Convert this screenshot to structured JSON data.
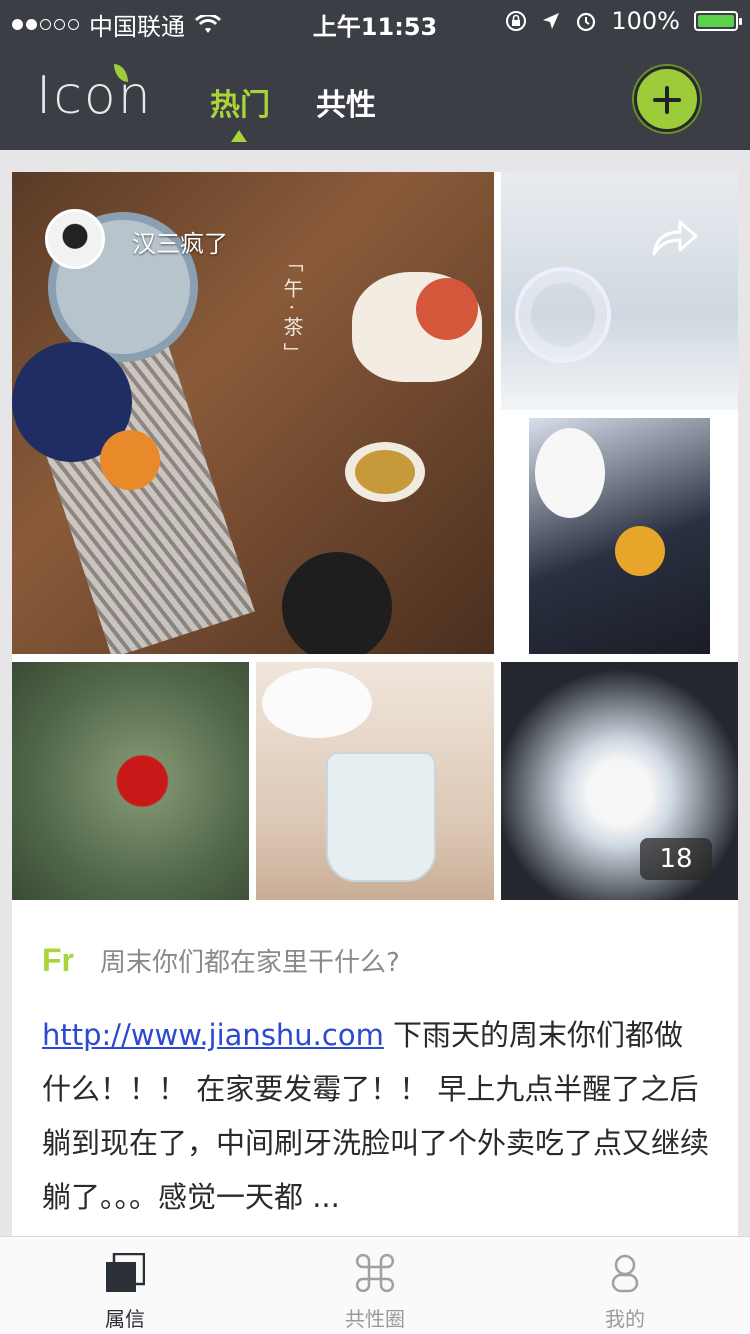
{
  "status_bar": {
    "carrier": "中国联通",
    "time": "上午11:53",
    "battery": "100%",
    "battery_level": 1.0,
    "signal_dots_filled": 2,
    "signal_dots_total": 5,
    "icons": [
      "wifi-icon",
      "rotation-lock-icon",
      "location-icon",
      "alarm-icon",
      "battery-icon"
    ]
  },
  "nav": {
    "logo": "Icon",
    "tabs": [
      {
        "label": "热门",
        "active": true
      },
      {
        "label": "共性",
        "active": false
      }
    ],
    "accent_color": "#a9d43a",
    "add_icon": "plus-icon"
  },
  "post": {
    "author": "汉三疯了",
    "image_poem": "「午·茶」",
    "more_images_count": "18",
    "topic_icon": "Fr",
    "topic_title": "周末你们都在家里干什么?",
    "link": "http://www.jianshu.com",
    "body": " 下雨天的周末你们都做什么！！！ 在家要发霉了！！ 早上九点半醒了之后躺到现在了，中间刷牙洗脸叫了个外卖吃了点又继续躺了。。。感觉一天都 ..."
  },
  "tabbar": {
    "items": [
      {
        "label": "属信",
        "icon": "square-stack-icon",
        "selected": true
      },
      {
        "label": "共性圈",
        "icon": "command-icon",
        "selected": false
      },
      {
        "label": "我的",
        "icon": "person-icon",
        "selected": false
      }
    ]
  }
}
